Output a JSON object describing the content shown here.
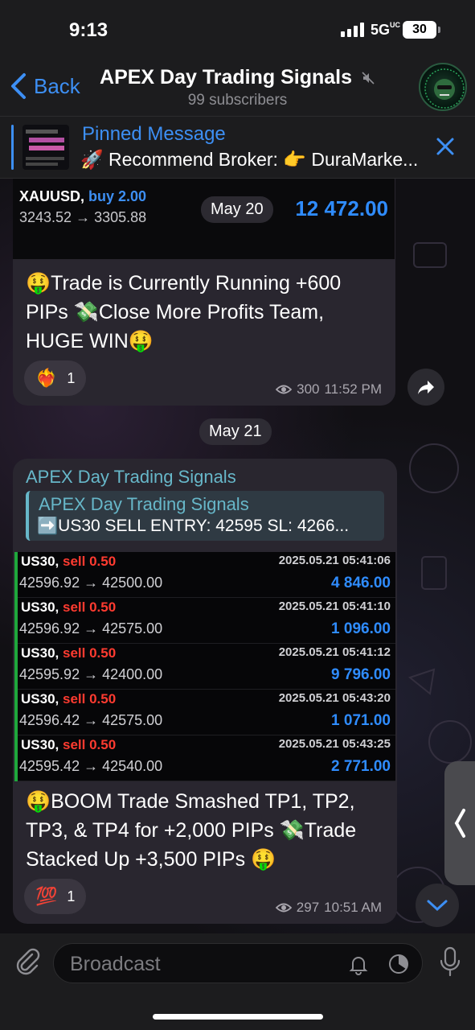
{
  "status": {
    "time": "9:13",
    "network": "5G",
    "network_suffix": "UC",
    "battery": "30"
  },
  "header": {
    "back_label": "Back",
    "title": "APEX Day Trading Signals",
    "subtitle": "99 subscribers"
  },
  "pinned": {
    "label": "Pinned Message",
    "text": "🚀 Recommend Broker: 👉 DuraMarke..."
  },
  "message1": {
    "trade": {
      "symbol": "XAUUSD,",
      "side": "buy 2.00",
      "range": "3243.52 → 3305.88",
      "profit": "12 472.00"
    },
    "date_pill": "May 20",
    "text": "🤑Trade is Currently Running +600 PIPs 💸Close More Profits Team, HUGE WIN🤑",
    "reaction_emoji": "❤️‍🔥",
    "reaction_count": "1",
    "views": "300",
    "time": "11:52 PM"
  },
  "date_separator": "May 21",
  "message2": {
    "forwarded_from": "APEX Day Trading Signals",
    "quote_title": "APEX Day Trading Signals",
    "quote_text": "➡️US30 SELL ENTRY: 42595 SL: 4266...",
    "trades": [
      {
        "symbol": "US30,",
        "side": "sell 0.50",
        "date": "2025.05.21 05:41:06",
        "range": "42596.92 → 42500.00",
        "profit": "4 846.00"
      },
      {
        "symbol": "US30,",
        "side": "sell 0.50",
        "date": "2025.05.21 05:41:10",
        "range": "42596.92 → 42575.00",
        "profit": "1 096.00"
      },
      {
        "symbol": "US30,",
        "side": "sell 0.50",
        "date": "2025.05.21 05:41:12",
        "range": "42595.92 → 42400.00",
        "profit": "9 796.00"
      },
      {
        "symbol": "US30,",
        "side": "sell 0.50",
        "date": "2025.05.21 05:43:20",
        "range": "42596.42 → 42575.00",
        "profit": "1 071.00"
      },
      {
        "symbol": "US30,",
        "side": "sell 0.50",
        "date": "2025.05.21 05:43:25",
        "range": "42595.42 → 42540.00",
        "profit": "2 771.00"
      }
    ],
    "text": "🤑BOOM Trade Smashed TP1, TP2, TP3, & TP4 for +2,000 PIPs 💸Trade Stacked Up +3,500 PIPs 🤑",
    "reaction_emoji": "💯",
    "reaction_count": "1",
    "views": "297",
    "time": "10:51 AM"
  },
  "input": {
    "placeholder": "Broadcast"
  },
  "icons": {
    "back": "chevron-left-icon",
    "mute": "mute-icon",
    "close": "close-icon",
    "share": "share-icon",
    "views": "eye-icon",
    "attach": "paperclip-icon",
    "bell": "bell-icon",
    "timer": "timer-icon",
    "mic": "microphone-icon",
    "scroll_down": "chevron-down-icon",
    "side_tab": "chevron-left-icon"
  },
  "colors": {
    "accent": "#3d8ff4",
    "bubble": "#29262f",
    "profit": "#2f8cff",
    "sell": "#ff3b30",
    "bar_green": "#1fa83c"
  }
}
